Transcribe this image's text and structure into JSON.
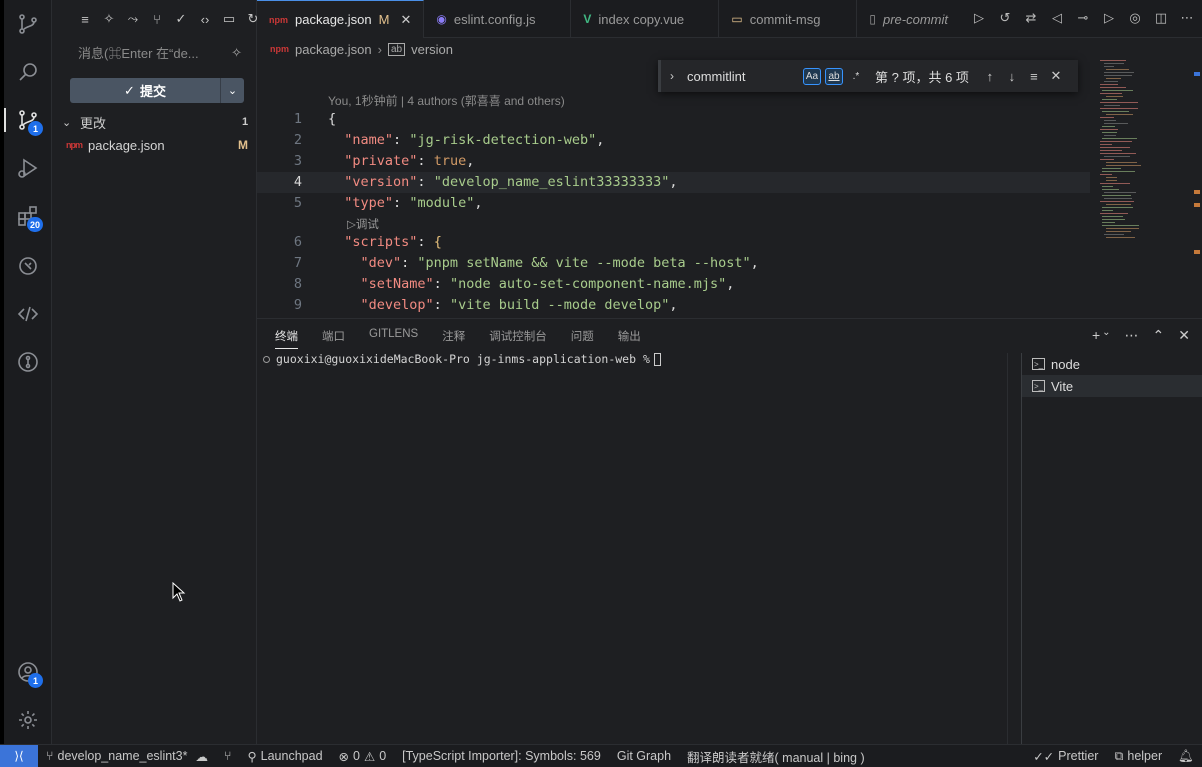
{
  "activity_bar": {
    "source_control_badge": "1",
    "extensions_badge": "20",
    "accounts_badge": "1"
  },
  "sidebar": {
    "commit_message_placeholder": "消息(⌘Enter 在“de...",
    "commit_label": "提交",
    "changes_label": "更改",
    "changes_count": "1",
    "files": [
      {
        "name": "package.json",
        "status": "M"
      }
    ]
  },
  "tabs": [
    {
      "label": "package.json",
      "status": "M",
      "active": true
    },
    {
      "label": "eslint.config.js"
    },
    {
      "label": "index copy.vue"
    },
    {
      "label": "commit-msg"
    },
    {
      "label": "pre-commit"
    }
  ],
  "breadcrumb": {
    "file": "package.json",
    "symbol": "version"
  },
  "find_widget": {
    "term": "commitlint",
    "match_case": "Aa",
    "whole_word": "ab",
    "regex": ".*",
    "result": "第 ? 项，共 6 项"
  },
  "editor": {
    "blame": "You, 1秒钟前 | 4 authors (郭喜喜 and others)",
    "codelens": "▷调试",
    "lines": [
      {
        "n": "1",
        "tokens": [
          [
            "p",
            "{"
          ]
        ]
      },
      {
        "n": "2",
        "tokens": [
          [
            "p",
            "  "
          ],
          [
            "k",
            "\"name\""
          ],
          [
            "p",
            ": "
          ],
          [
            "s",
            "\"jg-risk-detection-web\""
          ],
          [
            "p",
            ","
          ]
        ]
      },
      {
        "n": "3",
        "tokens": [
          [
            "p",
            "  "
          ],
          [
            "k",
            "\"private\""
          ],
          [
            "p",
            ": "
          ],
          [
            "b",
            "true"
          ],
          [
            "p",
            ","
          ]
        ]
      },
      {
        "n": "4",
        "tokens": [
          [
            "p",
            "  "
          ],
          [
            "k",
            "\"version\""
          ],
          [
            "p",
            ": "
          ],
          [
            "s",
            "\"develop_name_eslint33333333\""
          ],
          [
            "p",
            ","
          ]
        ],
        "current": true
      },
      {
        "n": "5",
        "tokens": [
          [
            "p",
            "  "
          ],
          [
            "k",
            "\"type\""
          ],
          [
            "p",
            ": "
          ],
          [
            "s",
            "\"module\""
          ],
          [
            "p",
            ","
          ]
        ]
      },
      {
        "n": "6",
        "tokens": [
          [
            "p",
            "  "
          ],
          [
            "k",
            "\"scripts\""
          ],
          [
            "p",
            ": "
          ],
          [
            "br",
            "{"
          ]
        ]
      },
      {
        "n": "7",
        "tokens": [
          [
            "p",
            "    "
          ],
          [
            "k",
            "\"dev\""
          ],
          [
            "p",
            ": "
          ],
          [
            "s",
            "\"pnpm setName && vite --mode beta --host\""
          ],
          [
            "p",
            ","
          ]
        ]
      },
      {
        "n": "8",
        "tokens": [
          [
            "p",
            "    "
          ],
          [
            "k",
            "\"setName\""
          ],
          [
            "p",
            ": "
          ],
          [
            "s",
            "\"node auto-set-component-name.mjs\""
          ],
          [
            "p",
            ","
          ]
        ]
      },
      {
        "n": "9",
        "tokens": [
          [
            "p",
            "    "
          ],
          [
            "k",
            "\"develop\""
          ],
          [
            "p",
            ": "
          ],
          [
            "s",
            "\"vite build --mode develop\""
          ],
          [
            "p",
            ","
          ]
        ]
      }
    ]
  },
  "panel": {
    "tabs": [
      "终端",
      "端口",
      "GITLENS",
      "注释",
      "调试控制台",
      "问题",
      "输出"
    ],
    "prompt": "guoxixi@guoxixideMacBook-Pro jg-inms-application-web % ",
    "terminals": [
      {
        "name": "node"
      },
      {
        "name": "Vite",
        "selected": true
      }
    ]
  },
  "statusbar": {
    "branch": "develop_name_eslint3*",
    "launchpad": "Launchpad",
    "errors": "0",
    "warnings": "0",
    "ts_importer": "[TypeScript Importer]: Symbols: 569",
    "git_graph": "Git Graph",
    "reader": "翻译朗读者就绪( manual | bing )",
    "prettier": "Prettier",
    "helper": "helper"
  },
  "colors": {
    "accent": "#1f6feb",
    "modified": "#e2c08d",
    "remote": "#3b74d9"
  }
}
